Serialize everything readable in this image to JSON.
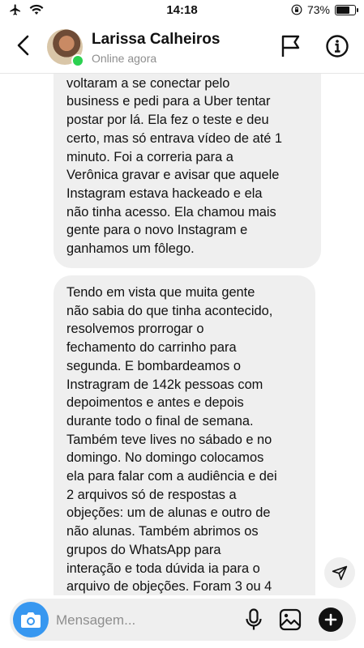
{
  "status_bar": {
    "time": "14:18",
    "battery": "73%",
    "battery_level": 0.73
  },
  "header": {
    "contact_name": "Larissa Calheiros",
    "contact_status": "Online agora"
  },
  "messages": [
    {
      "lines": [
        "voltaram a se conectar pelo",
        "business e pedi para a Uber tentar",
        "postar por lá. Ela fez o teste e deu",
        "certo, mas só entrava vídeo de até 1",
        "minuto. Foi a correria para a",
        "Verônica gravar e avisar que aquele",
        "Instagram estava hackeado e ela",
        "não tinha acesso. Ela chamou mais",
        "gente para o novo Instagram e",
        "ganhamos um fôlego."
      ]
    },
    {
      "lines": [
        "Tendo em vista que muita gente",
        "não sabia do que tinha acontecido,",
        "resolvemos prorrogar o",
        "fechamento do carrinho para",
        "segunda. E bombardeamos o",
        "Instragram de 142k pessoas com",
        "depoimentos e antes e depois",
        "durante todo o final de semana.",
        "Também teve lives no sábado e no",
        "domingo. No domingo colocamos",
        "ela para falar com a audiência e dei",
        "2 arquivos só de respostas a",
        "objeções: um de alunas e outro de",
        "não alunas. Também abrimos os",
        "grupos do WhatsApp para",
        "interação e toda dúvida ia para o",
        "arquivo de objeções. Foram 3 ou 4"
      ]
    }
  ],
  "composer": {
    "placeholder": "Mensagem..."
  }
}
